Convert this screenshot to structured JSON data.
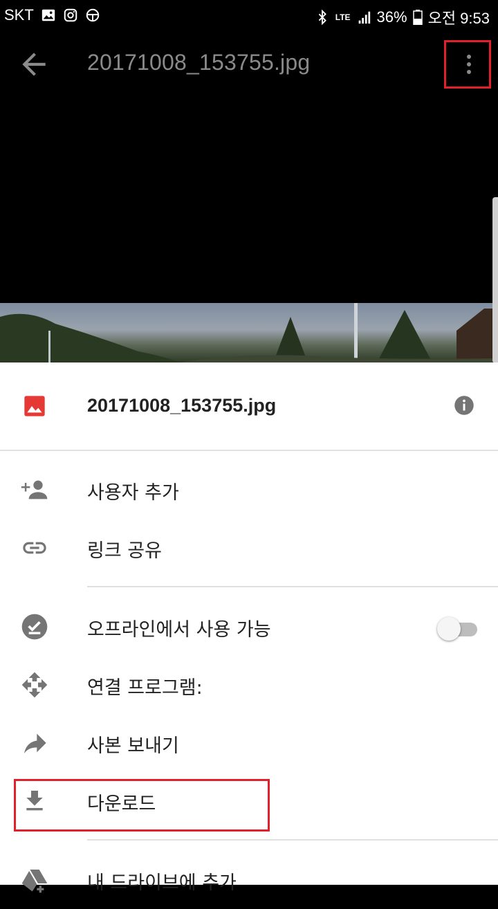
{
  "status_bar": {
    "carrier": "SKT",
    "network": "LTE",
    "battery": "36%",
    "time": "오전 9:53",
    "icons": [
      "gallery-icon",
      "instagram-icon",
      "steering-icon",
      "bluetooth-icon",
      "lte-icon",
      "signal-icon",
      "battery-icon"
    ]
  },
  "toolbar": {
    "title": "20171008_153755.jpg",
    "back_icon": "arrow-left-icon",
    "more_icon": "more-vert-icon"
  },
  "sheet": {
    "file_name": "20171008_153755.jpg",
    "file_icon": "image-file-icon",
    "info_icon": "info-icon",
    "items": [
      {
        "label": "사용자 추가",
        "icon": "person-add-icon"
      },
      {
        "label": "링크 공유",
        "icon": "link-icon"
      },
      {
        "label": "오프라인에서 사용 가능",
        "icon": "offline-check-icon",
        "toggle_on": false
      },
      {
        "label": "연결 프로그램:",
        "icon": "open-with-icon"
      },
      {
        "label": "사본 보내기",
        "icon": "share-arrow-icon"
      },
      {
        "label": "다운로드",
        "icon": "download-icon"
      },
      {
        "label": "내 드라이브에 추가",
        "icon": "drive-add-icon"
      }
    ]
  },
  "colors": {
    "highlight": "#e0202a",
    "image_icon": "#e53935",
    "icon_gray": "#757575"
  }
}
